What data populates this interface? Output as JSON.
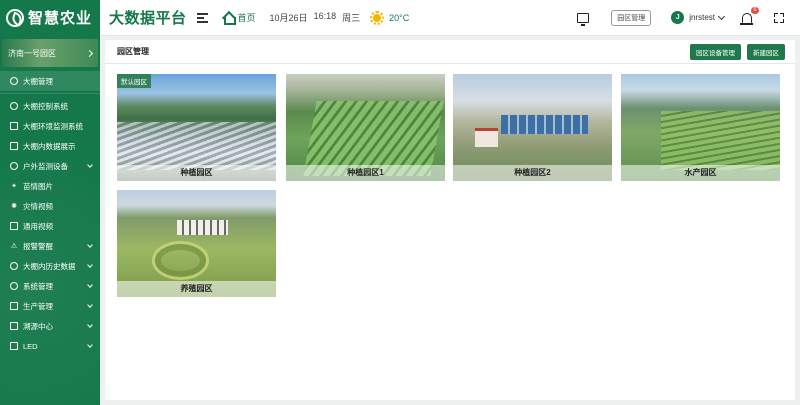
{
  "header": {
    "logo_text": "智慧农业",
    "platform_title": "大数据平台",
    "home_label": "首页",
    "date": "10月26日",
    "time": "16:18",
    "weekday": "周三",
    "temperature": "20°C",
    "park_mgmt_label": "园区管理",
    "avatar_letter": "J",
    "username": "jnrstest",
    "notification_count": "6"
  },
  "sidebar": {
    "park_name": "济南一号园区",
    "items": [
      {
        "label": "大棚管理",
        "icon": "home-icon",
        "arrow": false
      },
      {
        "label": "大棚控制系统",
        "icon": "control-icon",
        "arrow": false
      },
      {
        "label": "大棚环境监测系统",
        "icon": "monitor-icon",
        "arrow": false
      },
      {
        "label": "大棚内数据展示",
        "icon": "data-icon",
        "arrow": false
      },
      {
        "label": "户外监测设备",
        "icon": "device-icon",
        "arrow": true
      },
      {
        "label": "苗情图片",
        "icon": "image-icon",
        "arrow": false
      },
      {
        "label": "灾情视频",
        "icon": "video-icon",
        "arrow": false
      },
      {
        "label": "通用视频",
        "icon": "camera-icon",
        "arrow": false
      },
      {
        "label": "报警警醒",
        "icon": "warning-icon",
        "arrow": true
      },
      {
        "label": "大棚内历史数据",
        "icon": "history-icon",
        "arrow": true
      },
      {
        "label": "系统管理",
        "icon": "settings-icon",
        "arrow": true
      },
      {
        "label": "生产管理",
        "icon": "production-icon",
        "arrow": true
      },
      {
        "label": "溯源中心",
        "icon": "trace-icon",
        "arrow": true
      },
      {
        "label": "LED",
        "icon": "led-icon",
        "arrow": true
      }
    ]
  },
  "main": {
    "title": "园区管理",
    "btn_device": "园区设备管理",
    "btn_new": "新建园区",
    "default_tag": "默认园区",
    "parks": [
      {
        "name": "种植园区"
      },
      {
        "name": "种植园区1"
      },
      {
        "name": "种植园区2"
      },
      {
        "name": "水产园区"
      },
      {
        "name": "养殖园区"
      }
    ]
  },
  "colors": {
    "brand_green": "#14784a",
    "badge_red": "#e94b3c",
    "sun_yellow": "#f4b400"
  }
}
